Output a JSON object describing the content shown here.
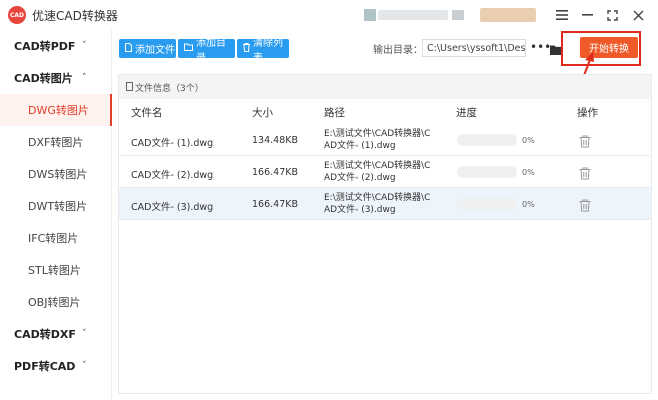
{
  "window": {
    "logo_text": "CAD",
    "title": "优速CAD转换器",
    "menu_icon": "menu-icon",
    "minimize_icon": "minimize-icon",
    "maximize_icon": "maximize-icon",
    "close_icon": "close-icon"
  },
  "sidebar": {
    "groups": [
      {
        "label": "CAD转PDF",
        "chevron": "˅"
      },
      {
        "label": "CAD转图片",
        "chevron": "˄"
      },
      {
        "label": "CAD转DXF",
        "chevron": "˅"
      },
      {
        "label": "PDF转CAD",
        "chevron": "˅"
      }
    ],
    "items": [
      {
        "label": "DWG转图片",
        "active": true
      },
      {
        "label": "DXF转图片"
      },
      {
        "label": "DWS转图片"
      },
      {
        "label": "DWT转图片"
      },
      {
        "label": "IFC转图片"
      },
      {
        "label": "STL转图片"
      },
      {
        "label": "OBJ转图片"
      }
    ]
  },
  "toolbar": {
    "add_file": "添加文件",
    "add_dir": "添加目录",
    "clear_list": "清除列表",
    "output_label": "输出目录：",
    "output_path": "C:\\Users\\yssoft1\\Deskt",
    "dots": "•••",
    "start": "开始转换"
  },
  "panel": {
    "header": "文件信息（3个）",
    "columns": {
      "name": "文件名",
      "size": "大小",
      "path": "路径",
      "progress": "进度",
      "action": "操作"
    },
    "rows": [
      {
        "name": "CAD文件- (1).dwg",
        "size": "134.48KB",
        "path1": "E:\\测试文件\\CAD转换器\\C",
        "path2": "AD文件- (1).dwg",
        "pct": "0%",
        "progress": 0
      },
      {
        "name": "CAD文件- (2).dwg",
        "size": "166.47KB",
        "path1": "E:\\测试文件\\CAD转换器\\C",
        "path2": "AD文件- (2).dwg",
        "pct": "0%",
        "progress": 0
      },
      {
        "name": "CAD文件- (3).dwg",
        "size": "166.47KB",
        "path1": "E:\\测试文件\\CAD转换器\\C",
        "path2": "AD文件- (3).dwg",
        "pct": "0%",
        "progress": 0
      }
    ]
  },
  "colors": {
    "accent_blue": "#2a9cf0",
    "start_orange": "#ef5a28",
    "highlight_red": "#e02a1c",
    "active_text": "#e0402a"
  }
}
